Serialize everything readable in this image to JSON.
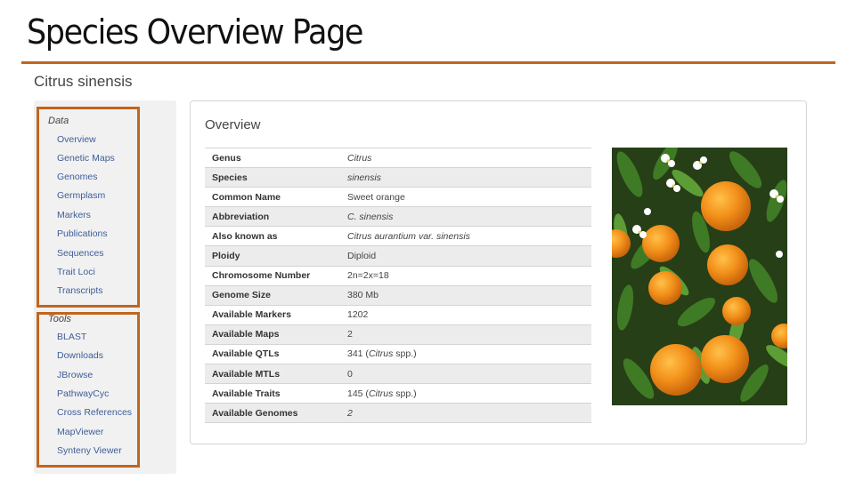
{
  "slide": {
    "title": "Species Overview Page"
  },
  "species": {
    "heading": "Citrus sinensis"
  },
  "sidebar": {
    "data_label": "Data",
    "data_items": [
      "Overview",
      "Genetic Maps",
      "Genomes",
      "Germplasm",
      "Markers",
      "Publications",
      "Sequences",
      "Trait Loci",
      "Transcripts"
    ],
    "tools_label": "Tools",
    "tools_items": [
      "BLAST",
      "Downloads",
      "JBrowse",
      "PathwayCyc",
      "Cross References",
      "MapViewer",
      "Synteny Viewer"
    ]
  },
  "overview": {
    "title": "Overview",
    "rows": [
      {
        "label": "Genus",
        "value": "Citrus"
      },
      {
        "label": "Species",
        "value": "sinensis"
      },
      {
        "label": "Common Name",
        "value": "Sweet orange"
      },
      {
        "label": "Abbreviation",
        "value": "C. sinensis"
      },
      {
        "label": "Also known as",
        "value_italic": "Citrus aurantium",
        "value_tail": " var. sinensis"
      },
      {
        "label": "Ploidy",
        "value": "Diploid"
      },
      {
        "label": "Chromosome Number",
        "value": "2n=2x=18"
      },
      {
        "label": "Genome Size",
        "value": "380 Mb"
      },
      {
        "label": "Available Markers",
        "value": "1202"
      },
      {
        "label": "Available Maps",
        "value": "2"
      },
      {
        "label": "Available QTLs",
        "value_head": "341 (",
        "value_italic": "Citrus",
        "value_tail": " spp.)"
      },
      {
        "label": "Available MTLs",
        "value": "0"
      },
      {
        "label": "Available Traits",
        "value_head": "145 (",
        "value_italic": "Citrus",
        "value_tail": " spp.)"
      },
      {
        "label": "Available Genomes",
        "value": "2"
      }
    ]
  },
  "colors": {
    "accent": "#c0661f",
    "link": "#3d5e98",
    "sidebar_bg": "#f1f1f1",
    "row_stripe": "#ececec"
  }
}
